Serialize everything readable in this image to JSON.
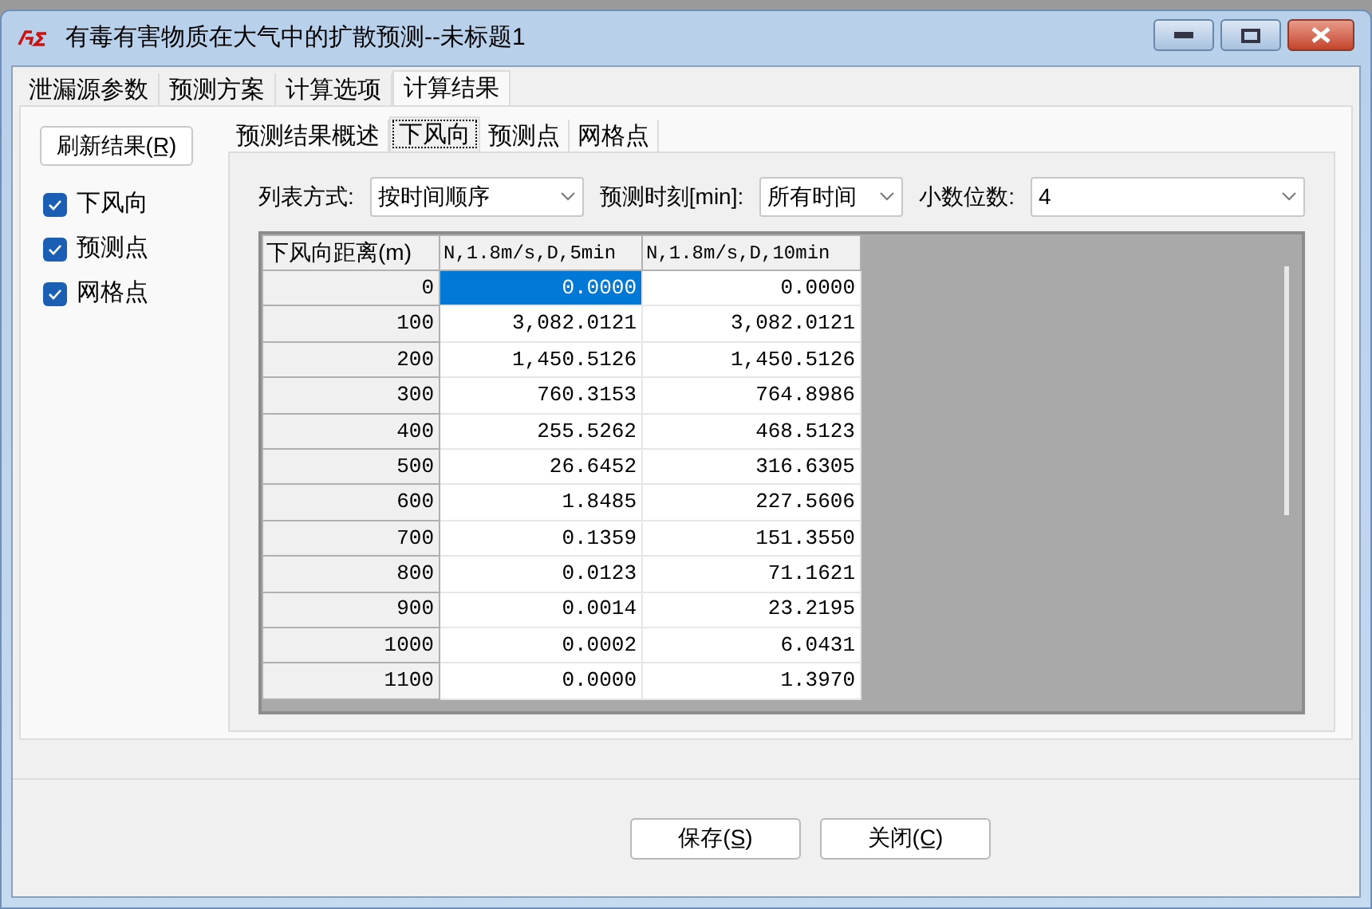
{
  "window": {
    "title": "有毒有害物质在大气中的扩散预测--未标题1"
  },
  "tabs": [
    {
      "label": "泄漏源参数",
      "selected": false
    },
    {
      "label": "预测方案",
      "selected": false
    },
    {
      "label": "计算选项",
      "selected": false
    },
    {
      "label": "计算结果",
      "selected": true
    }
  ],
  "refresh_button": "刷新结果(R̲)",
  "checkboxes": [
    {
      "label": "下风向",
      "checked": true
    },
    {
      "label": "预测点",
      "checked": true
    },
    {
      "label": "网格点",
      "checked": true
    }
  ],
  "sub_tabs": [
    {
      "label": "预测结果概述",
      "selected": false
    },
    {
      "label": "下风向",
      "selected": true
    },
    {
      "label": "预测点",
      "selected": false
    },
    {
      "label": "网格点",
      "selected": false
    }
  ],
  "filters": [
    {
      "label": "列表方式:",
      "value": "按时间顺序"
    },
    {
      "label": "预测时刻[min]:",
      "value": "所有时间"
    },
    {
      "label": "小数位数:",
      "value": "4"
    }
  ],
  "table": {
    "columns": [
      "下风向距离(m)",
      "N,1.8m/s,D,5min",
      "N,1.8m/s,D,10min"
    ],
    "rows": [
      {
        "cells": [
          "0",
          "0.0000",
          "0.0000"
        ],
        "selected": [
          false,
          true,
          false
        ]
      },
      {
        "cells": [
          "100",
          "3,082.0121",
          "3,082.0121"
        ]
      },
      {
        "cells": [
          "200",
          "1,450.5126",
          "1,450.5126"
        ]
      },
      {
        "cells": [
          "300",
          "760.3153",
          "764.8986"
        ]
      },
      {
        "cells": [
          "400",
          "255.5262",
          "468.5123"
        ]
      },
      {
        "cells": [
          "500",
          "26.6452",
          "316.6305"
        ]
      },
      {
        "cells": [
          "600",
          "1.8485",
          "227.5606"
        ]
      },
      {
        "cells": [
          "700",
          "0.1359",
          "151.3550"
        ]
      },
      {
        "cells": [
          "800",
          "0.0123",
          "71.1621"
        ]
      },
      {
        "cells": [
          "900",
          "0.0014",
          "23.2195"
        ]
      },
      {
        "cells": [
          "1000",
          "0.0002",
          "6.0431"
        ]
      },
      {
        "cells": [
          "1100",
          "0.0000",
          "1.3970"
        ]
      }
    ]
  },
  "buttons": [
    "保存(S̲)",
    "关闭(C̲)"
  ]
}
